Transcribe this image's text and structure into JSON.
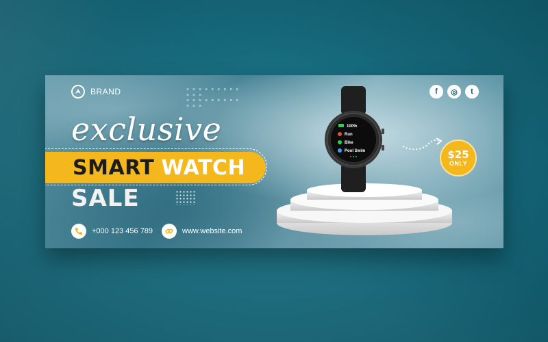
{
  "brand": {
    "name": "BRAND"
  },
  "social": [
    "f",
    "◎",
    "t"
  ],
  "social_icons": [
    "facebook-icon",
    "instagram-icon",
    "twitter-icon"
  ],
  "headline": {
    "script": "exclusive",
    "smart": "SMART",
    "watch": "WATCH",
    "sale": "SALE"
  },
  "contact": {
    "phone": "+000 123 456 789",
    "website": "www.website.com"
  },
  "watch_screen": {
    "battery": "100%",
    "items": [
      "Run",
      "Bike",
      "Pool Swim"
    ]
  },
  "price": {
    "value": "$25",
    "label": "ONLY"
  },
  "colors": {
    "accent": "#f5b81c",
    "background": "#15687a",
    "dark": "#1c1c1c"
  }
}
